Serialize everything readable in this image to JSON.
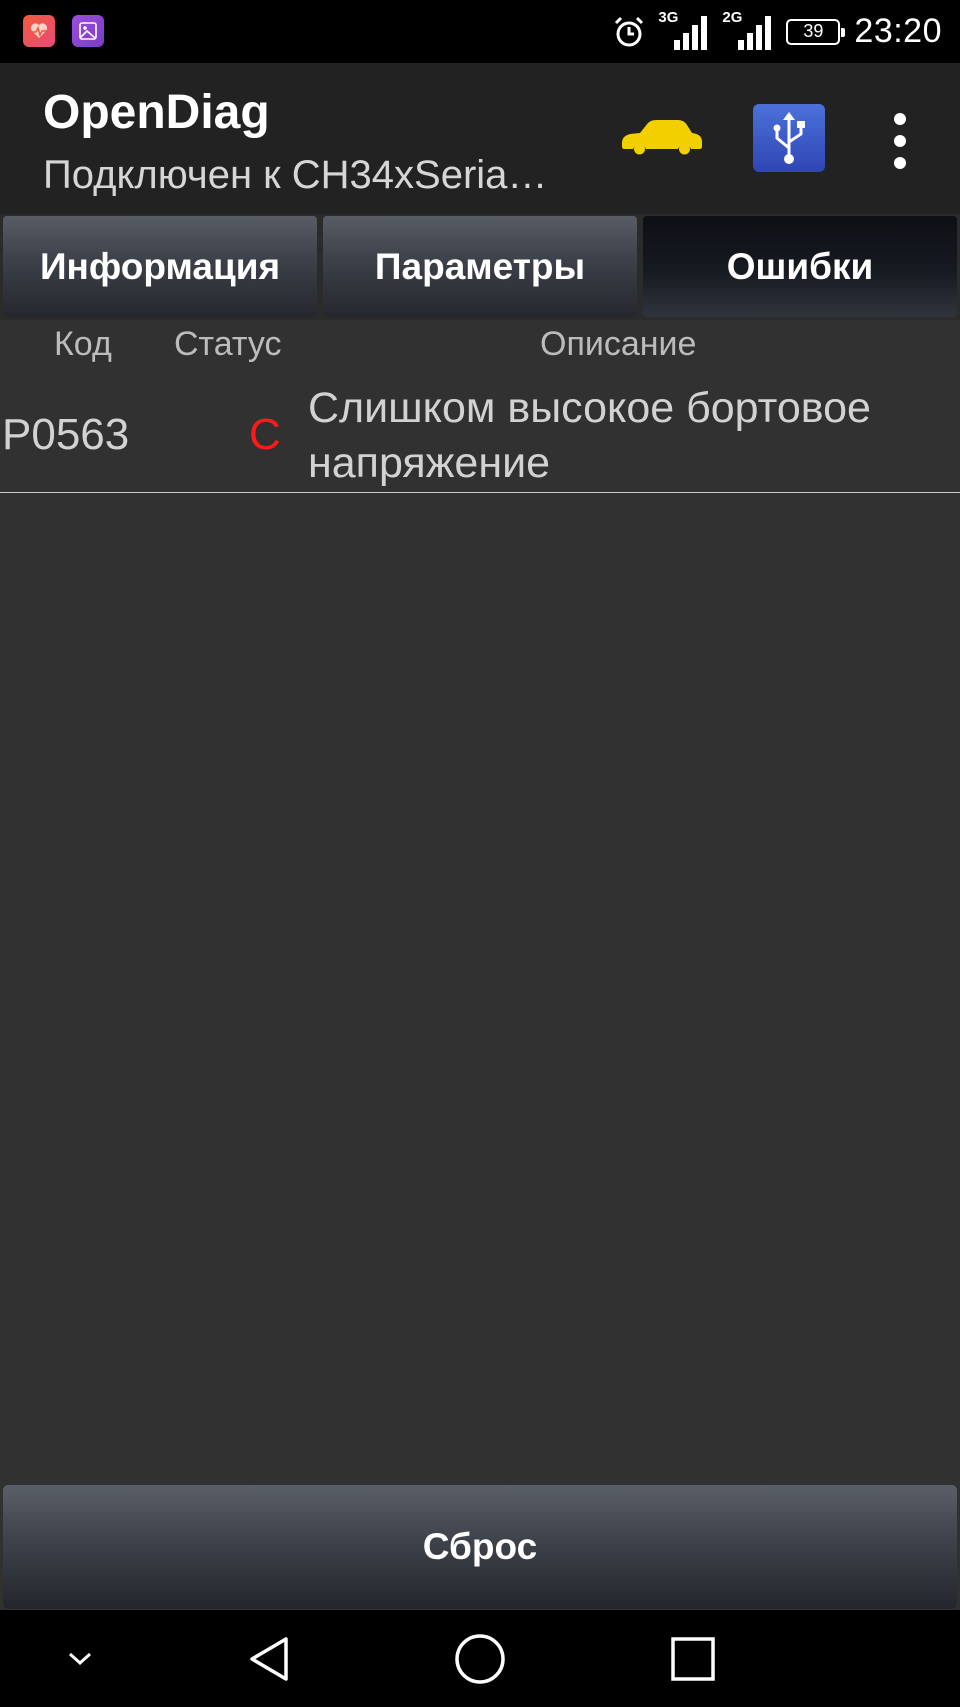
{
  "status_bar": {
    "notifications": [
      "health-app-icon",
      "gallery-app-icon"
    ],
    "alarm_icon": "alarm-clock-icon",
    "network_1": "3G",
    "network_2": "2G",
    "battery": "39",
    "time": "23:20"
  },
  "action_bar": {
    "title": "OpenDiag",
    "subtitle": "Подключен к CH34xSeria…",
    "car_icon": "car-icon",
    "car_color": "#f2d000",
    "usb_icon": "usb-icon",
    "menu_icon": "overflow-menu-icon"
  },
  "tabs": [
    {
      "label": "Информация",
      "active": false
    },
    {
      "label": "Параметры",
      "active": false
    },
    {
      "label": "Ошибки",
      "active": true
    }
  ],
  "errors_table": {
    "columns": [
      "Код",
      "Статус",
      "Описание"
    ],
    "rows": [
      {
        "code": "P0563",
        "status": "C",
        "status_color": "#ff1a1a",
        "description": "Слишком высокое бортовое напряжение"
      }
    ]
  },
  "reset_button": {
    "label": "Сброс"
  },
  "nav_bar": {
    "buttons": [
      "hide-keyboard-chevron-icon",
      "back-triangle-icon",
      "home-circle-icon",
      "recents-square-icon"
    ]
  }
}
